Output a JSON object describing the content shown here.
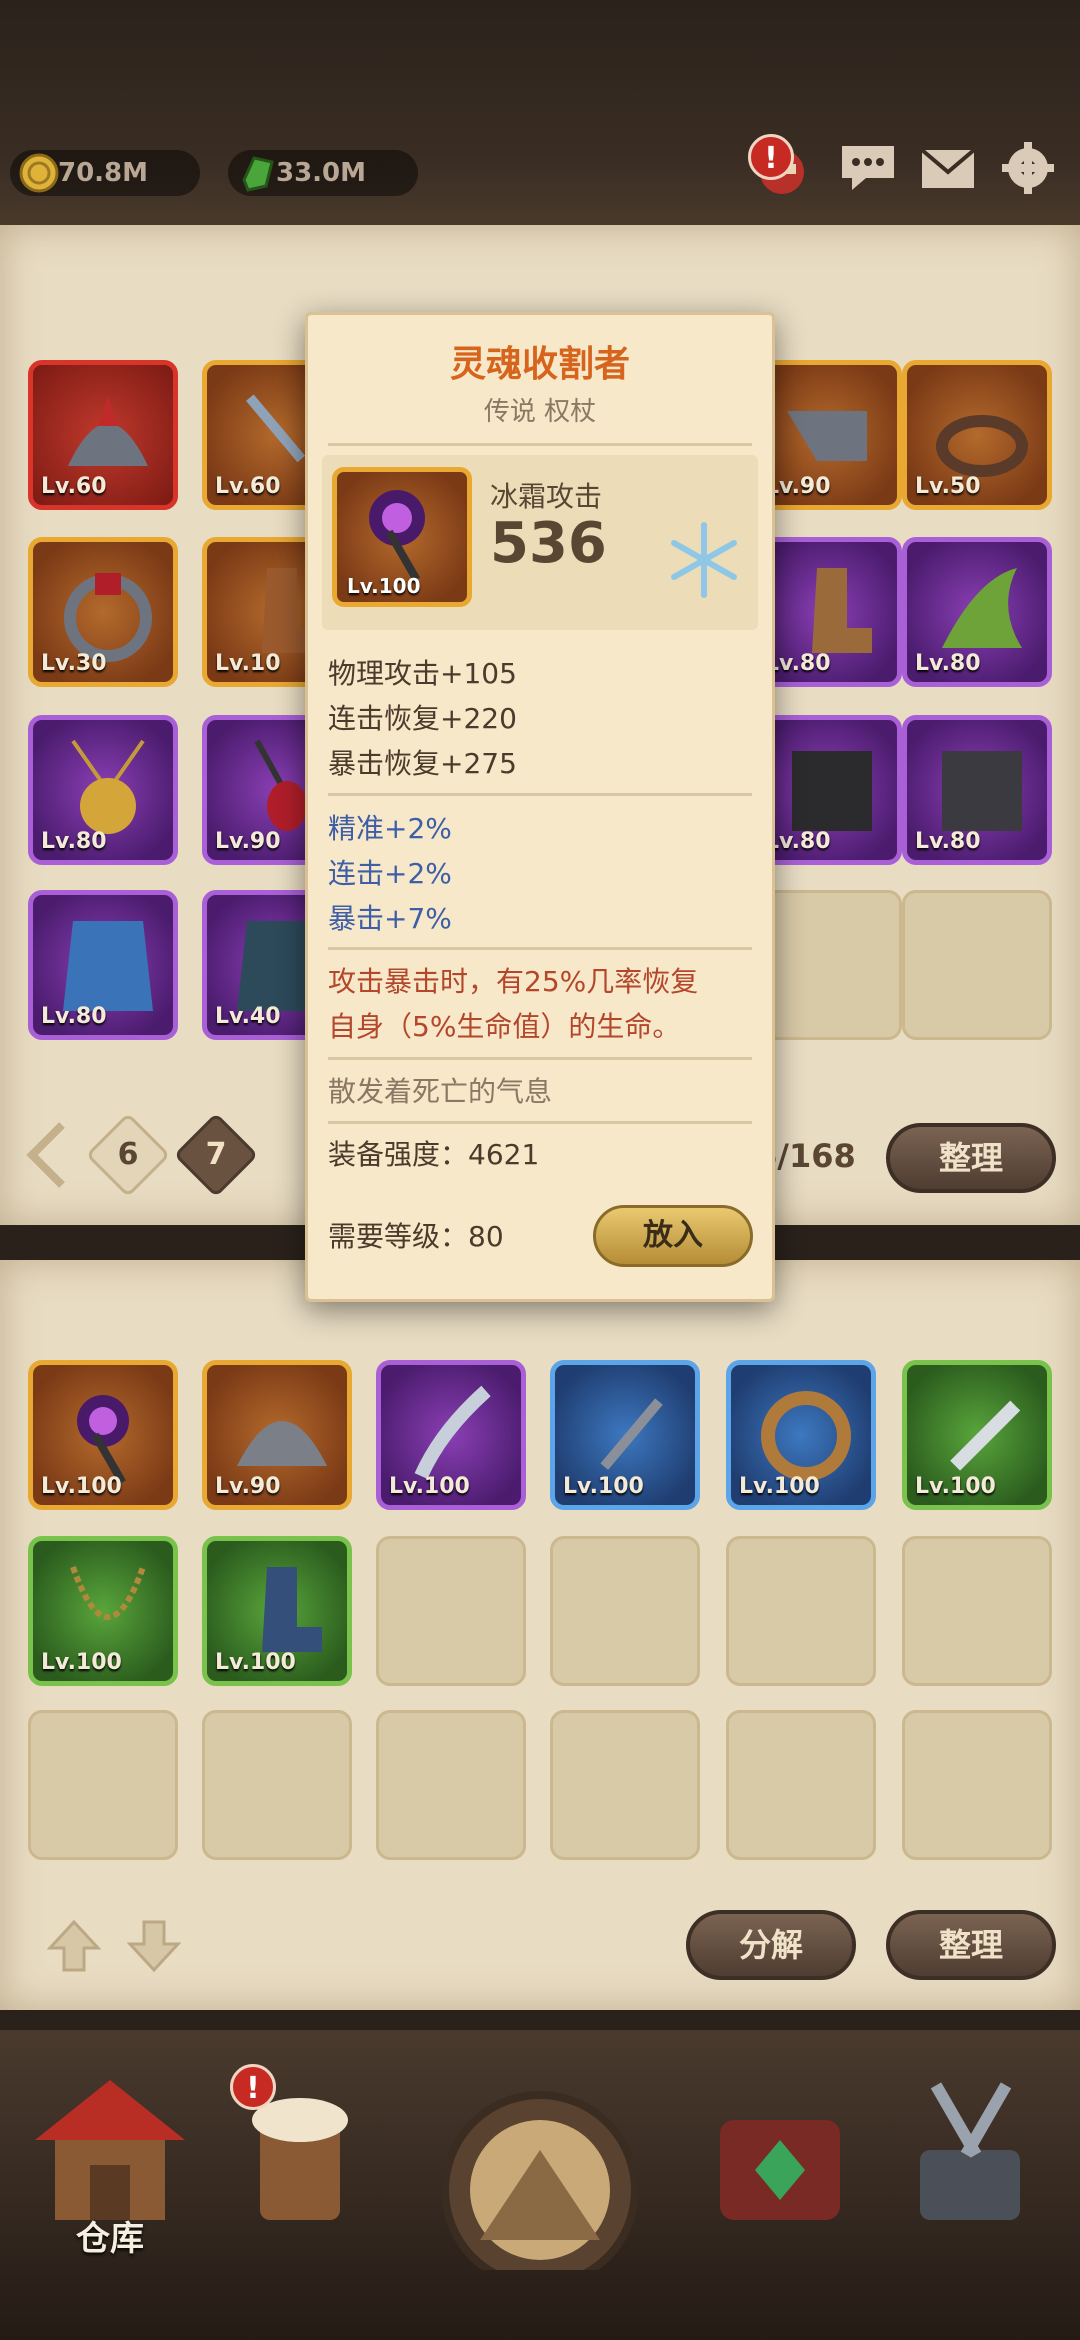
{
  "currencies": {
    "gold": "70.8M",
    "gems": "33.0M"
  },
  "top_icons": {
    "profile_badge": "!",
    "chat": "chat-icon",
    "mail": "mail-icon",
    "settings": "gear-icon"
  },
  "storage": {
    "items": [
      {
        "level": "Lv.60",
        "rarity": "red"
      },
      {
        "level": "Lv.60",
        "rarity": "gold"
      },
      {
        "level": "Lv.90",
        "rarity": "gold"
      },
      {
        "level": "Lv.50",
        "rarity": "gold"
      },
      {
        "level": "Lv.30",
        "rarity": "gold"
      },
      {
        "level": "Lv.10",
        "rarity": "gold"
      },
      {
        "level": "Lv.80",
        "rarity": "purple"
      },
      {
        "level": "Lv.80",
        "rarity": "purple"
      },
      {
        "level": "Lv.80",
        "rarity": "purple"
      },
      {
        "level": "Lv.90",
        "rarity": "purple"
      },
      {
        "level": "Lv.80",
        "rarity": "purple"
      },
      {
        "level": "Lv.80",
        "rarity": "purple"
      },
      {
        "level": "Lv.80",
        "rarity": "purple"
      },
      {
        "level": "Lv.40",
        "rarity": "purple"
      }
    ],
    "pages": [
      "6",
      "7"
    ],
    "capacity": "6/168",
    "sort_label": "整理"
  },
  "tooltip": {
    "name": "灵魂收割者",
    "type": "传说 权杖",
    "item_level": "Lv.100",
    "main_stat_label": "冰霜攻击",
    "main_stat_value": "536",
    "stats": [
      "物理攻击+105",
      "连击恢复+220",
      "暴击恢复+275"
    ],
    "bonuses": [
      "精准+2%",
      "连击+2%",
      "暴击+7%"
    ],
    "effect_line1": "攻击暴击时，有25%几率恢复",
    "effect_line2": "自身（5%生命值）的生命。",
    "flavor": "散发着死亡的气息",
    "power": "装备强度：4621",
    "required_level": "需要等级：80",
    "put_in_label": "放入"
  },
  "backpack": {
    "items": [
      {
        "level": "Lv.100",
        "rarity": "gold"
      },
      {
        "level": "Lv.90",
        "rarity": "gold"
      },
      {
        "level": "Lv.100",
        "rarity": "purple"
      },
      {
        "level": "Lv.100",
        "rarity": "blue"
      },
      {
        "level": "Lv.100",
        "rarity": "blue"
      },
      {
        "level": "Lv.100",
        "rarity": "green"
      },
      {
        "level": "Lv.100",
        "rarity": "green"
      },
      {
        "level": "Lv.100",
        "rarity": "green"
      }
    ],
    "decompose_label": "分解",
    "sort_label": "整理"
  },
  "bottom_nav": {
    "warehouse_label": "仓库",
    "tavern_badge": "!"
  }
}
